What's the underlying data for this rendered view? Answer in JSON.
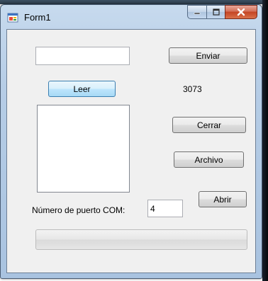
{
  "window": {
    "title": "Form1"
  },
  "form": {
    "send_input_value": "",
    "send_button": "Enviar",
    "read_button": "Leer",
    "count_label": "3073",
    "close_button": "Cerrar",
    "file_button": "Archivo",
    "port_label": "Número de puerto COM:",
    "port_value": "4",
    "open_button": "Abrir",
    "list_items": [],
    "progress_fraction": 0
  },
  "colors": {
    "title_bar": "#b6cde6",
    "client_bg": "#f0f0f0",
    "close_button": "#c44424",
    "focused_button": "#bee6fd"
  },
  "icons": {
    "app": "form-icon",
    "minimize": "minimize-icon",
    "maximize": "maximize-icon",
    "close": "close-icon"
  }
}
